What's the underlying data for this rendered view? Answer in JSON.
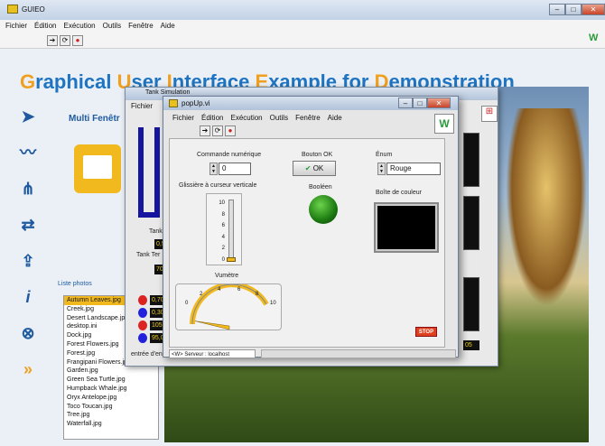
{
  "app": {
    "title": "GUIEO",
    "menu": [
      "Fichier",
      "Édition",
      "Exécution",
      "Outils",
      "Fenêtre",
      "Aide"
    ]
  },
  "banner": {
    "segments": [
      {
        "t": "G",
        "hl": true
      },
      {
        "t": "raphical ",
        "hl": false
      },
      {
        "t": "U",
        "hl": true
      },
      {
        "t": "ser ",
        "hl": false
      },
      {
        "t": "I",
        "hl": true
      },
      {
        "t": "nterface ",
        "hl": false
      },
      {
        "t": "E",
        "hl": true
      },
      {
        "t": "xample for ",
        "hl": false
      },
      {
        "t": "D",
        "hl": true
      },
      {
        "t": "emonstration",
        "hl": false
      }
    ]
  },
  "side": {
    "multi": "Multi Fenêtr",
    "photos_label": "Liste photos",
    "photos": [
      "Autumn Leaves.jpg",
      "Creek.jpg",
      "Desert Landscape.jpg",
      "desktop.ini",
      "Dock.jpg",
      "Forest Flowers.jpg",
      "Forest.jpg",
      "Frangipani Flowers.jpg",
      "Garden.jpg",
      "Green Sea Turtle.jpg",
      "Humpback Whale.jpg",
      "Oryx Antelope.jpg",
      "Toco Toucan.jpg",
      "Tree.jpg",
      "Waterfall.jpg"
    ]
  },
  "tank": {
    "title": "Tank Simulation",
    "menu": "Fichier",
    "tank_label": "Tank",
    "tank_temp_label": "Tank Ter",
    "v1": "0,5",
    "v2": "70",
    "rows": [
      "0,70",
      "0,30",
      "105,",
      "95,0"
    ],
    "entry": "entrée d'en",
    "right_val": "05"
  },
  "popup": {
    "title": "popUp.vi",
    "menu": [
      "Fichier",
      "Édition",
      "Exécution",
      "Outils",
      "Fenêtre",
      "Aide"
    ],
    "cmd_label": "Commande numérique",
    "cmd_value": "0",
    "ok_label": "Bouton OK",
    "ok_text": "OK",
    "enum_label": "Énum",
    "enum_value": "Rouge",
    "slider_label": "Glissière à curseur verticale",
    "slider_ticks": [
      "10",
      "8",
      "6",
      "4",
      "2",
      "0"
    ],
    "slider_value": 0,
    "bool_label": "Booléen",
    "color_label": "Boîte de couleur",
    "gauge_label": "Vumètre",
    "gauge_ticks": [
      "0",
      "2",
      "4",
      "6",
      "8",
      "10"
    ],
    "gauge_value": 0,
    "stop": "STOP",
    "status": "<W> Serveur : localhost"
  },
  "colors": {
    "accent": "#1e74c2",
    "highlight": "#f0a020",
    "led_on": "#2a8a1a",
    "stop": "#e04020"
  }
}
